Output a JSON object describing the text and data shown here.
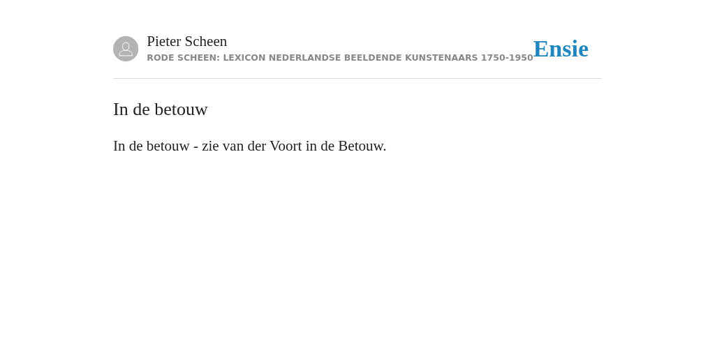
{
  "header": {
    "author": "Pieter Scheen",
    "source": "RODE SCHEEN: LEXICON NEDERLANDSE BEELDENDE KUNSTENAARS 1750-1950",
    "logo": "Ensie"
  },
  "article": {
    "title": "In de betouw",
    "body": "In de betouw - zie van der Voort in de Betouw."
  }
}
